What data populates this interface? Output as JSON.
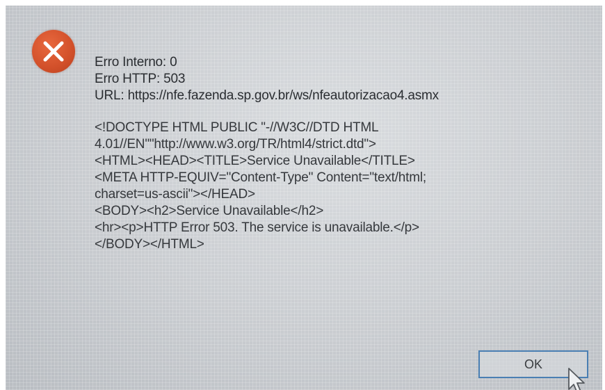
{
  "dialog": {
    "icon": "error-icon",
    "icon_color": "#d2502a",
    "error_lines": [
      "Erro Interno: 0",
      "Erro HTTP: 503",
      "URL: https://nfe.fazenda.sp.gov.br/ws/nfeautorizacao4.asmx"
    ],
    "response_lines": [
      "<!DOCTYPE HTML PUBLIC \"-//W3C//DTD HTML",
      "4.01//EN\"\"http://www.w3.org/TR/html4/strict.dtd\">",
      "<HTML><HEAD><TITLE>Service Unavailable</TITLE>",
      "<META HTTP-EQUIV=\"Content-Type\" Content=\"text/html;",
      "charset=us-ascii\"></HEAD>",
      "<BODY><h2>Service Unavailable</h2>",
      "<hr><p>HTTP Error 503. The service is unavailable.</p>",
      "</BODY></HTML>"
    ],
    "ok_label": "OK",
    "button_border_color": "#4a7fb3"
  }
}
